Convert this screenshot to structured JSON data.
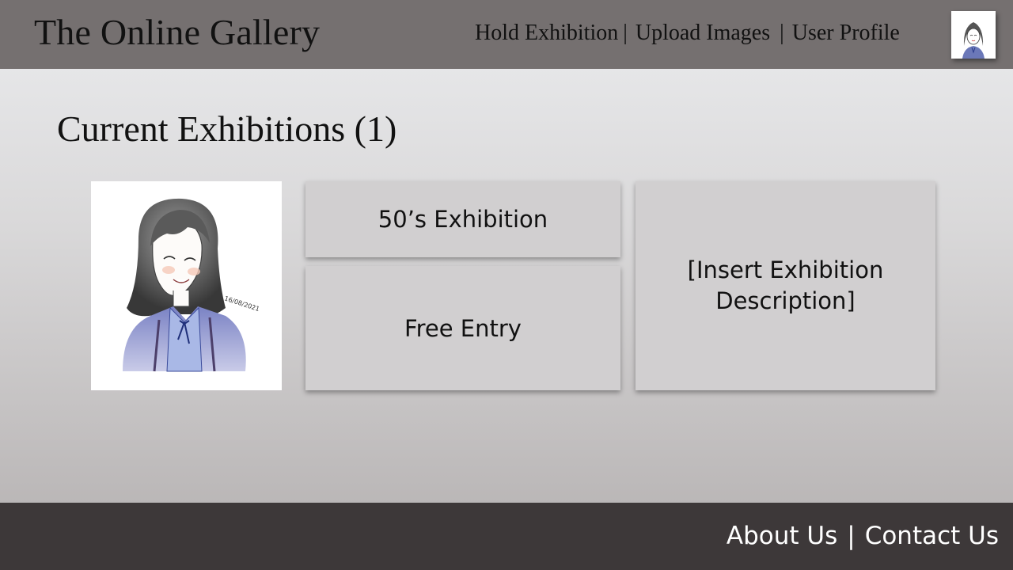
{
  "header": {
    "site_title": "The Online Gallery",
    "nav": {
      "hold_exhibition": "Hold Exhibition",
      "sep1": "|",
      "upload_images": "Upload Images",
      "sep2": "|",
      "user_profile": "User Profile"
    },
    "avatar_icon": "user-avatar-portrait"
  },
  "main": {
    "heading": "Current Exhibitions (1)",
    "exhibition": {
      "artwork_icon": "portrait-drawing",
      "artwork_signature": "16/08/2021",
      "name": "50’s Exhibition",
      "entry": "Free Entry",
      "description": "[Insert Exhibition Description]"
    }
  },
  "footer": {
    "about": "About Us",
    "sep": "|",
    "contact": "Contact Us"
  },
  "colors": {
    "header_bg": "#757070",
    "footer_bg": "#3d3839",
    "card_bg": "#d1cfd0"
  }
}
